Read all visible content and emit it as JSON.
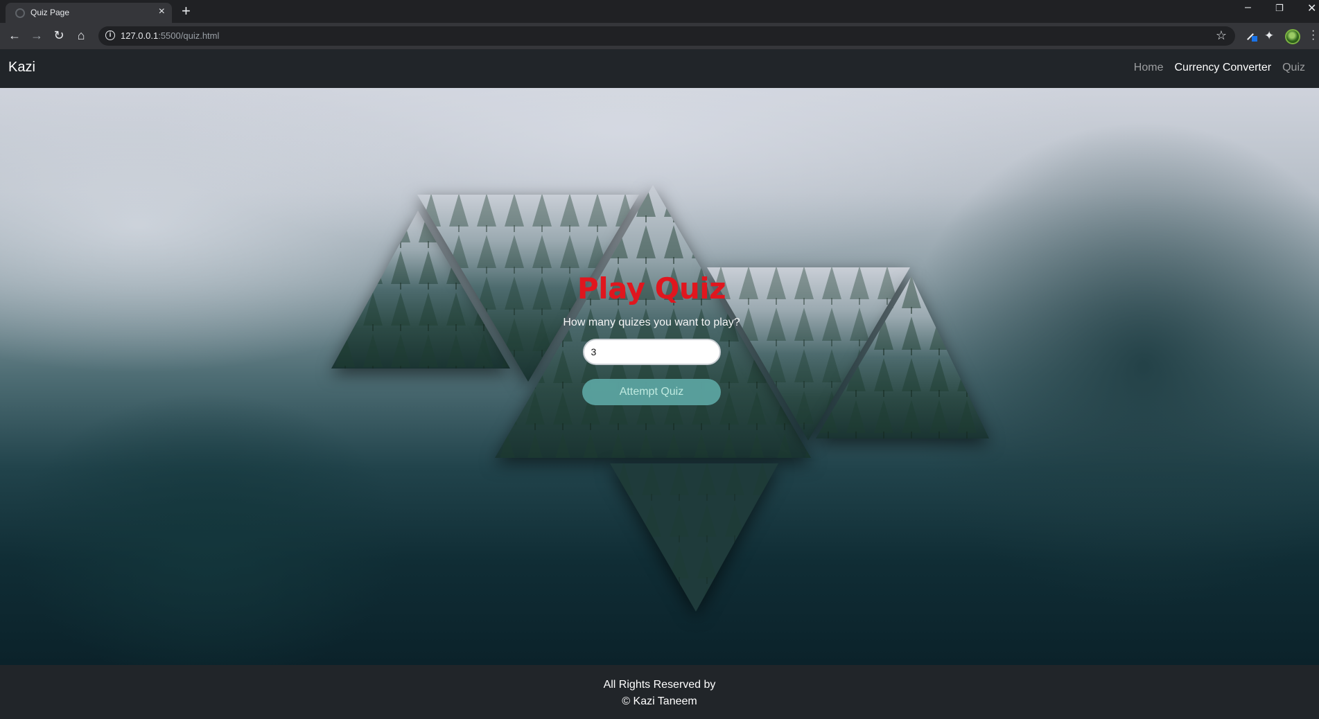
{
  "browser": {
    "tab_title": "Quiz Page",
    "url_host": "127.0.0.1",
    "url_path": ":5500/quiz.html"
  },
  "navbar": {
    "brand": "Kazi",
    "links": [
      "Home",
      "Currency Converter",
      "Quiz"
    ],
    "active_link": "Currency Converter"
  },
  "quiz": {
    "title": "Play Quiz",
    "question": "How many quizes you want to play?",
    "count_value": "3",
    "button_label": "Attempt Quiz"
  },
  "footer": {
    "line1": "All Rights Reserved by",
    "line2": "© Kazi Taneem"
  },
  "colors": {
    "title_red": "#e0161e",
    "button_teal": "#5ba3a0",
    "navbar_bg": "#212529"
  }
}
